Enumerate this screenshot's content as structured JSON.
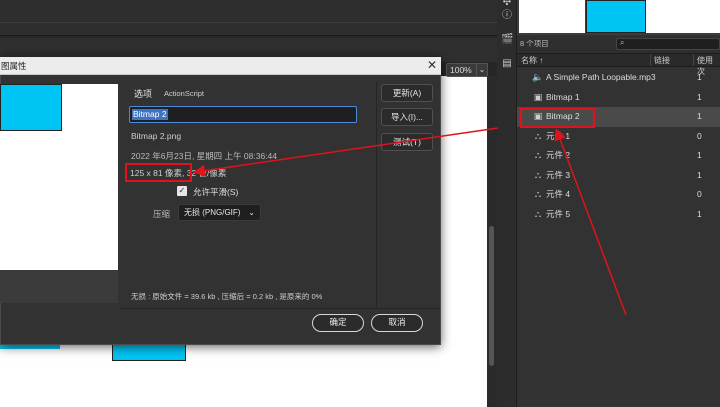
{
  "stage": {
    "zoom": "100%"
  },
  "library": {
    "item_count": "8 个项目",
    "columns": {
      "name": "名称 ↑",
      "linkage": "链接",
      "use_count": "使用次"
    },
    "items": [
      {
        "icon": "sound-icon",
        "name": "A Simple Path Loopable.mp3",
        "use": "1"
      },
      {
        "icon": "bitmap-icon",
        "name": "Bitmap 1",
        "use": "1"
      },
      {
        "icon": "bitmap-icon",
        "name": "Bitmap 2",
        "use": "1",
        "selected": true
      },
      {
        "icon": "symbol-icon",
        "name": "元件 1",
        "use": "0"
      },
      {
        "icon": "symbol-icon",
        "name": "元件 2",
        "use": "1"
      },
      {
        "icon": "symbol-icon",
        "name": "元件 3",
        "use": "1"
      },
      {
        "icon": "symbol-icon",
        "name": "元件 4",
        "use": "0"
      },
      {
        "icon": "symbol-icon",
        "name": "元件 5",
        "use": "1"
      }
    ]
  },
  "dialog": {
    "title": "图属性",
    "tab_options": "选项",
    "tab_actionscript": "ActionScript",
    "name_value": "Bitmap 2",
    "file_name": "Bitmap 2.png",
    "date": "2022 年6月23日, 星期四  上午 08:36:44",
    "dimensions": "125 x 81 像素,  32 位/像素",
    "allow_smoothing": "允许平滑(S)",
    "compression_label": "压缩",
    "compression_value": "无损 (PNG/GIF)",
    "footer_info": "无损 : 原始文件 = 39.6 kb , 压缩后 = 0.2 kb , 是原来的 0%",
    "buttons": {
      "update": "更新(A)",
      "import": "导入(I)...",
      "test": "测试(T)",
      "ok": "确定",
      "cancel": "取消"
    }
  },
  "colors": {
    "accent": "#00c4f4",
    "annotation": "#e1121b",
    "selection": "#3d73c4"
  }
}
